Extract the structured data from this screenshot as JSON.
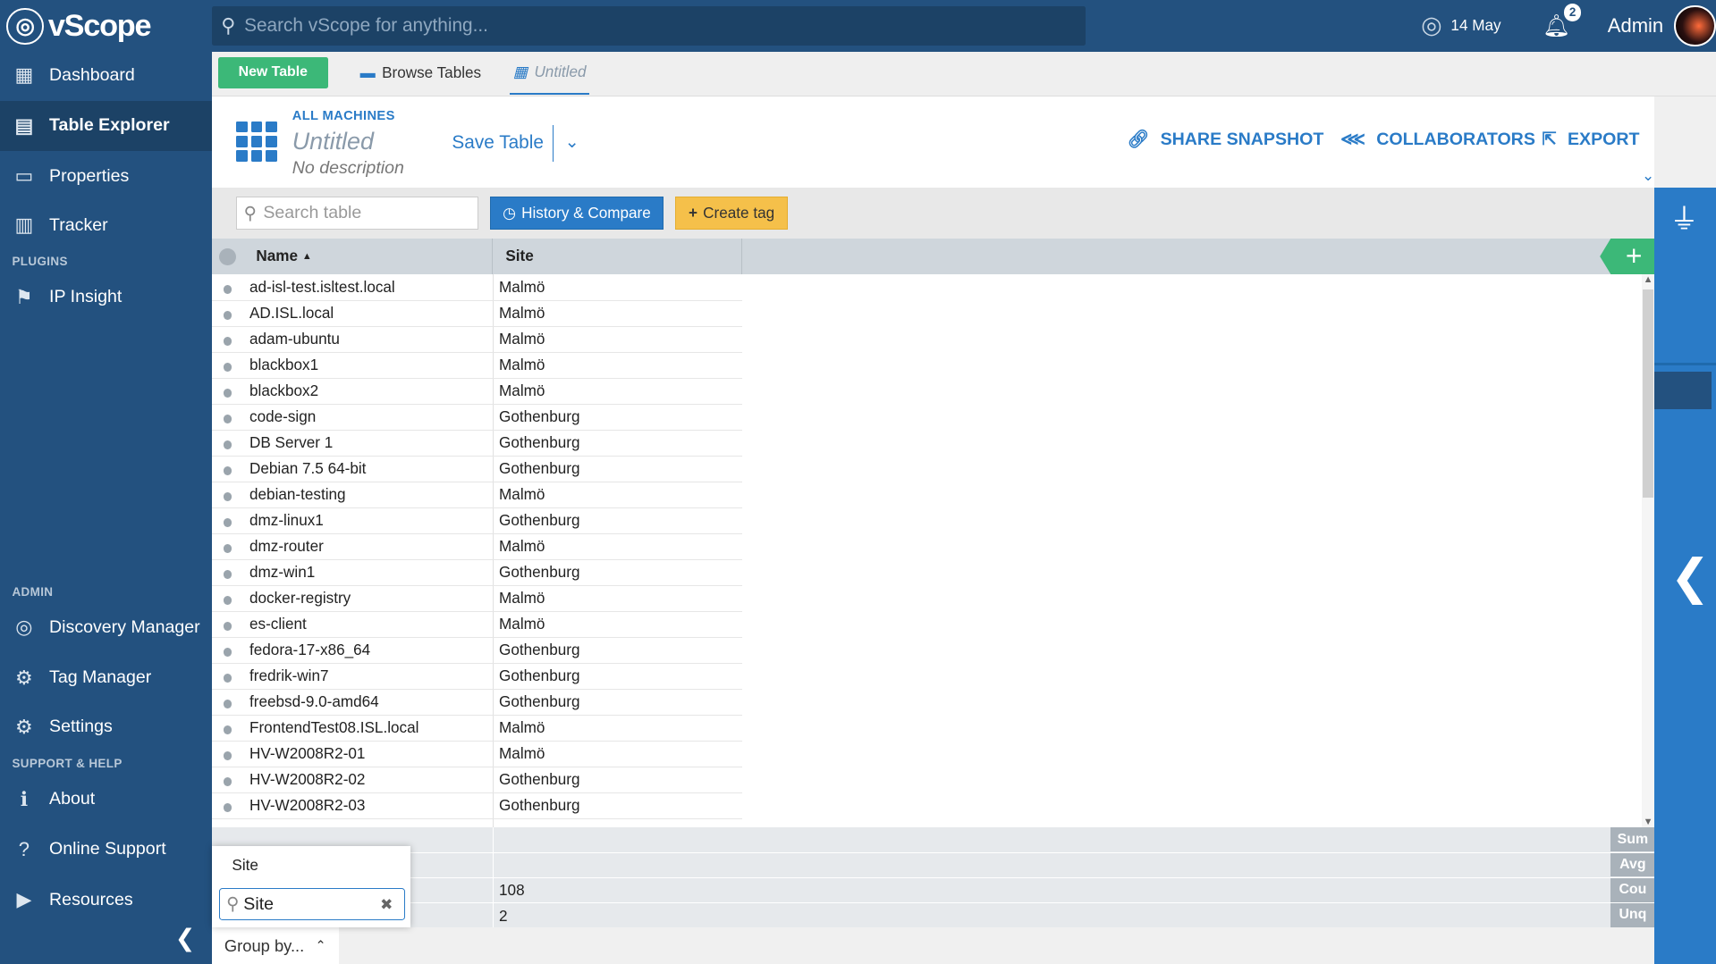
{
  "app": {
    "name": "vScope",
    "logo_glyph": "◎"
  },
  "search": {
    "placeholder": "Search vScope for anything..."
  },
  "topbar": {
    "date": "14 May",
    "notifications": "2",
    "user": "Admin"
  },
  "sidebar": {
    "items": [
      {
        "label": "Dashboard",
        "icon": "dashboard-icon",
        "glyph": "▦"
      },
      {
        "label": "Table Explorer",
        "icon": "table-icon",
        "glyph": "▤"
      },
      {
        "label": "Properties",
        "icon": "properties-icon",
        "glyph": "▭"
      },
      {
        "label": "Tracker",
        "icon": "tracker-icon",
        "glyph": "▥"
      }
    ],
    "plugins_heading": "PLUGINS",
    "plugins": [
      {
        "label": "IP Insight",
        "icon": "flag-icon",
        "glyph": "⚑"
      }
    ],
    "admin_heading": "ADMIN",
    "admin": [
      {
        "label": "Discovery Manager",
        "icon": "discovery-icon",
        "glyph": "◎"
      },
      {
        "label": "Tag Manager",
        "icon": "tag-icon",
        "glyph": "⚙"
      },
      {
        "label": "Settings",
        "icon": "settings-icon",
        "glyph": "⚙"
      }
    ],
    "support_heading": "SUPPORT & HELP",
    "support": [
      {
        "label": "About",
        "icon": "info-icon",
        "glyph": "ℹ"
      },
      {
        "label": "Online Support",
        "icon": "help-icon",
        "glyph": "?"
      },
      {
        "label": "Resources",
        "icon": "video-icon",
        "glyph": "▶"
      }
    ]
  },
  "tabs": {
    "new_table": "New Table",
    "browse": "Browse Tables",
    "untitled": "Untitled"
  },
  "header": {
    "breadcrumb": "ALL MACHINES",
    "title": "Untitled",
    "description": "No description",
    "save": "Save Table",
    "share": "SHARE SNAPSHOT",
    "collaborators": "COLLABORATORS",
    "export": "EXPORT"
  },
  "toolbar": {
    "search_placeholder": "Search table",
    "history": "History & Compare",
    "create_tag": "Create tag"
  },
  "table": {
    "columns": [
      "Name",
      "Site"
    ],
    "rows": [
      [
        "ad-isl-test.isltest.local",
        "Malmö"
      ],
      [
        "AD.ISL.local",
        "Malmö"
      ],
      [
        "adam-ubuntu",
        "Malmö"
      ],
      [
        "blackbox1",
        "Malmö"
      ],
      [
        "blackbox2",
        "Malmö"
      ],
      [
        "code-sign",
        "Gothenburg"
      ],
      [
        "DB Server 1",
        "Gothenburg"
      ],
      [
        "Debian 7.5 64-bit",
        "Gothenburg"
      ],
      [
        "debian-testing",
        "Malmö"
      ],
      [
        "dmz-linux1",
        "Gothenburg"
      ],
      [
        "dmz-router",
        "Malmö"
      ],
      [
        "dmz-win1",
        "Gothenburg"
      ],
      [
        "docker-registry",
        "Malmö"
      ],
      [
        "es-client",
        "Malmö"
      ],
      [
        "fedora-17-x86_64",
        "Gothenburg"
      ],
      [
        "fredrik-win7",
        "Gothenburg"
      ],
      [
        "freebsd-9.0-amd64",
        "Gothenburg"
      ],
      [
        "FrontendTest08.ISL.local",
        "Malmö"
      ],
      [
        "HV-W2008R2-01",
        "Malmö"
      ],
      [
        "HV-W2008R2-02",
        "Gothenburg"
      ],
      [
        "HV-W2008R2-03",
        "Gothenburg"
      ]
    ]
  },
  "footer": {
    "labels": [
      "Sum",
      "Avg",
      "Cou",
      "Unq"
    ],
    "site_count": "108",
    "site_unique": "2"
  },
  "groupby": {
    "label": "Group by...",
    "popup_item": "Site",
    "input_value": "Site"
  }
}
